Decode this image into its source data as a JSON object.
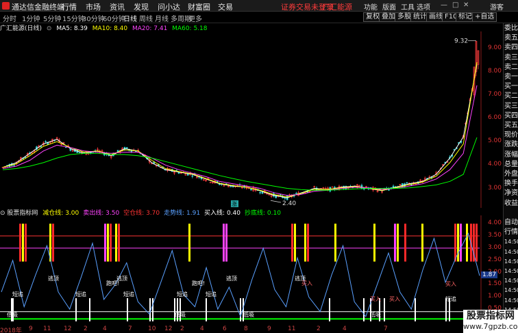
{
  "titlebar": {
    "app_name": "通达信金融终端",
    "menus": [
      "行情",
      "市场",
      "资讯",
      "发现",
      "问小达",
      "财富圈",
      "交易"
    ],
    "account": "证券交易未登录",
    "stock_tag": "广汇能源",
    "right_menus": [
      "功能",
      "版面",
      "工具",
      "选项"
    ],
    "guest": "游客"
  },
  "toolbar": {
    "periods": [
      "分时",
      "1分钟",
      "5分钟",
      "15分钟",
      "30分钟",
      "60分钟",
      "日线",
      "周线",
      "月线",
      "多周期",
      "更多"
    ],
    "active_period": "日线",
    "buttons": [
      "复权",
      "叠加",
      "多股",
      "统计",
      "画线",
      "F10",
      "标记",
      "+自选"
    ]
  },
  "chart_info": {
    "name": "广汇能源(日线)",
    "ma5": "MA5: 8.39",
    "ma10": "MA10: 8.40",
    "ma20": "MA20: 7.41",
    "ma60": "MA60: 5.18",
    "high_label": "9.32",
    "low_label": "2.40",
    "marker_label": "涨",
    "ma_colors": {
      "ma5": "#ffffff",
      "ma10": "#ffff00",
      "ma20": "#ff44ff",
      "ma60": "#00ff00"
    }
  },
  "indicator_info": {
    "name": "股票指标网",
    "lines": [
      {
        "label": "减仓线: 3.00",
        "color": "#ffff00"
      },
      {
        "label": "卖出线: 3.50",
        "color": "#ff44ff"
      },
      {
        "label": "空仓线: 3.70",
        "color": "#ff3333"
      },
      {
        "label": "走势线: 1.91",
        "color": "#5aa0ff"
      },
      {
        "label": "买入线: 0.40",
        "color": "#ffffff"
      },
      {
        "label": "抄底线: 0.10",
        "color": "#00ff00"
      }
    ],
    "current_value": "1.87",
    "signal_labels": [
      "短追",
      "短追",
      "短追",
      "短追",
      "短追",
      "短追",
      "低吸",
      "低吸",
      "低吸",
      "低吸",
      "逃顶",
      "逃顶",
      "逃顶",
      "逃顶",
      "跑吧!",
      "跑吧!",
      "买入",
      "买入",
      "买入",
      "买入"
    ]
  },
  "price_axis": [
    "9.00",
    "8.00",
    "7.00",
    "6.00",
    "5.00",
    "4.00",
    "3.00"
  ],
  "indicator_axis": [
    "4.00",
    "3.50",
    "3.00",
    "2.50",
    "2.00",
    "1.50",
    "1.00",
    "0.50"
  ],
  "sidebar": [
    "委比",
    "卖五",
    "卖四",
    "卖三",
    "卖二",
    "卖一",
    "买一",
    "买二",
    "买三",
    "买四",
    "买五",
    "现价",
    "涨跌",
    "涨幅",
    "总量",
    "外盘",
    "换手",
    "净资",
    "收益",
    "",
    "自动",
    "行情",
    "14:50",
    "14:50",
    "14:50",
    "14:50",
    "14:50",
    "14:50",
    "14:50",
    "14:50",
    "14:50"
  ],
  "time_axis": [
    "2018年",
    "9",
    "11",
    "12",
    "2",
    "4",
    "7",
    "10",
    "12",
    "2",
    "4",
    "6",
    "8",
    "9",
    "11",
    "2",
    "4",
    "7"
  ],
  "watermark": {
    "name": "股票指标网",
    "url": "www.7gpzb.com"
  },
  "chart_data": [
    {
      "type": "line",
      "title": "广汇能源(日线)",
      "ylim": [
        2.4,
        9.6
      ],
      "series": [
        {
          "name": "MA5",
          "values": [
            3.9,
            4.1,
            4.5,
            4.9,
            5.1,
            4.7,
            4.5,
            4.6,
            4.4,
            4.7,
            4.6,
            4.1,
            3.8,
            3.7,
            3.6,
            3.4,
            3.2,
            3.1,
            3.05,
            2.9,
            2.7,
            2.6,
            2.8,
            3.0,
            2.95,
            3.05,
            3.1,
            3.0,
            2.9,
            3.05,
            3.2,
            3.3,
            3.6,
            4.3,
            5.2,
            8.3
          ]
        },
        {
          "name": "MA10",
          "values": [
            3.9,
            4.05,
            4.4,
            4.8,
            5.0,
            4.75,
            4.55,
            4.6,
            4.45,
            4.65,
            4.6,
            4.2,
            3.85,
            3.72,
            3.62,
            3.42,
            3.22,
            3.12,
            3.05,
            2.92,
            2.74,
            2.63,
            2.78,
            2.96,
            2.96,
            3.03,
            3.08,
            3.01,
            2.92,
            3.03,
            3.16,
            3.27,
            3.52,
            4.1,
            4.9,
            8.4
          ]
        },
        {
          "name": "MA20",
          "values": [
            3.85,
            3.95,
            4.2,
            4.6,
            4.85,
            4.75,
            4.6,
            4.55,
            4.5,
            4.55,
            4.55,
            4.3,
            4.0,
            3.8,
            3.65,
            3.5,
            3.3,
            3.2,
            3.1,
            3.0,
            2.82,
            2.7,
            2.74,
            2.88,
            2.92,
            3.0,
            3.05,
            3.02,
            2.96,
            3.0,
            3.1,
            3.2,
            3.4,
            3.8,
            4.5,
            7.41
          ]
        },
        {
          "name": "MA60",
          "values": [
            3.8,
            3.85,
            3.95,
            4.1,
            4.3,
            4.45,
            4.5,
            4.5,
            4.45,
            4.45,
            4.4,
            4.3,
            4.15,
            4.0,
            3.85,
            3.7,
            3.55,
            3.42,
            3.3,
            3.2,
            3.1,
            3.0,
            2.95,
            2.92,
            2.92,
            2.95,
            2.98,
            3.0,
            3.0,
            3.0,
            3.02,
            3.08,
            3.15,
            3.3,
            3.6,
            5.18
          ]
        }
      ],
      "annotations": [
        "9.32",
        "2.40"
      ]
    },
    {
      "type": "line",
      "title": "股票指标网",
      "ylim": [
        0,
        4.2
      ],
      "series": [
        {
          "name": "走势线",
          "values": [
            1.2,
            2.5,
            0.6,
            1.9,
            3.1,
            1.2,
            0.5,
            1.8,
            3.2,
            0.9,
            1.5,
            2.4,
            0.8,
            0.3,
            1.6,
            2.9,
            1.1,
            0.6,
            2.2,
            0.5,
            1.4,
            0.2,
            1.7,
            3.0,
            1.3,
            0.6,
            2.6,
            1.0,
            0.4,
            1.9,
            3.1,
            0.8,
            0.2,
            1.5,
            2.8,
            1.2,
            0.5,
            2.1,
            3.4,
            1.6,
            2.7,
            3.6,
            1.87
          ]
        },
        {
          "name": "减仓线",
          "values": [
            3.0
          ]
        },
        {
          "name": "卖出线",
          "values": [
            3.5
          ]
        },
        {
          "name": "空仓线",
          "values": [
            3.7
          ]
        },
        {
          "name": "买入线",
          "values": [
            0.4
          ]
        },
        {
          "name": "抄底线",
          "values": [
            0.1
          ]
        }
      ]
    }
  ]
}
